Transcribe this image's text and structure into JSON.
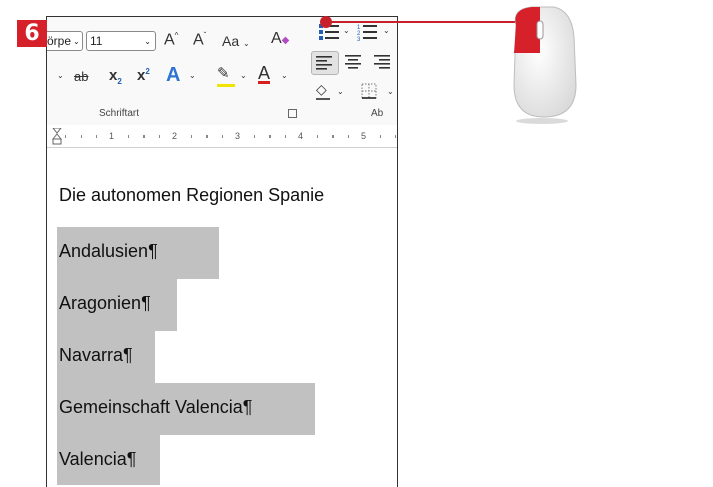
{
  "step": {
    "number": "6"
  },
  "ribbon": {
    "font_name": "örpe",
    "font_size": "11",
    "grow_label": "A",
    "shrink_label": "A",
    "case_label": "Aa",
    "strikethrough_label": "ab",
    "subscript_label": "x",
    "subscript_mark": "2",
    "superscript_label": "x",
    "superscript_mark": "2",
    "texteffects_label": "A",
    "fontcolor_label": "A",
    "group_font_label": "Schriftart",
    "group_paragraph_label": "Ab"
  },
  "ruler": {
    "marks": [
      "1",
      "2",
      "3",
      "4",
      "5"
    ]
  },
  "document": {
    "heading": "Die autonomen Regionen Spanie",
    "lines": [
      {
        "text": "Andalusien",
        "mark": "¶"
      },
      {
        "text": "Aragonien",
        "mark": "¶"
      },
      {
        "text": "Navarra",
        "mark": "¶"
      },
      {
        "text": "Gemeinschaft Valencia",
        "mark": "¶"
      },
      {
        "text": "Valencia",
        "mark": "¶"
      }
    ]
  },
  "colors": {
    "accent": "#d6202a",
    "selection": "#c1c1c1",
    "highlight": "#f0e400",
    "font_color": "#d62020"
  },
  "icons": [
    "bullets-icon",
    "numbering-icon",
    "align-left-icon",
    "align-center-icon",
    "align-right-icon",
    "shading-icon",
    "borders-icon",
    "mouse-left-click-icon"
  ]
}
